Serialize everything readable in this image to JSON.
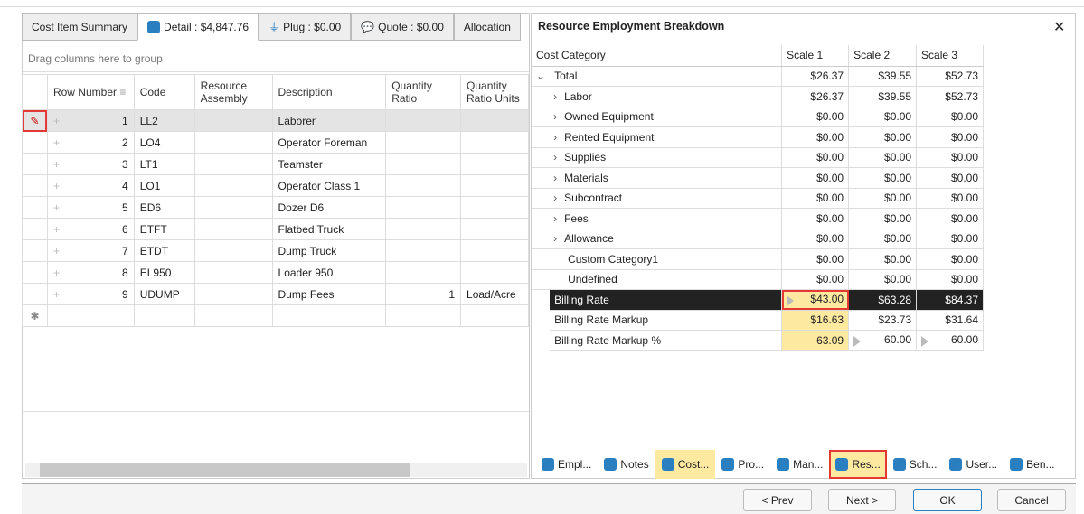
{
  "tabs": [
    {
      "label": "Cost Item Summary"
    },
    {
      "label": "Detail : $4,847.76"
    },
    {
      "label": "Plug : $0.00"
    },
    {
      "label": "Quote : $0.00"
    },
    {
      "label": "Allocation"
    }
  ],
  "group_hint": "Drag columns here to group",
  "grid": {
    "columns": [
      "Row Number",
      "Code",
      "Resource Assembly",
      "Description",
      "Quantity Ratio",
      "Quantity Ratio Units"
    ],
    "rows": [
      {
        "n": "1",
        "code": "LL2",
        "asm": "",
        "desc": "Laborer",
        "qty": "",
        "units": ""
      },
      {
        "n": "2",
        "code": "LO4",
        "asm": "",
        "desc": "Operator Foreman",
        "qty": "",
        "units": ""
      },
      {
        "n": "3",
        "code": "LT1",
        "asm": "",
        "desc": "Teamster",
        "qty": "",
        "units": ""
      },
      {
        "n": "4",
        "code": "LO1",
        "asm": "",
        "desc": "Operator Class 1",
        "qty": "",
        "units": ""
      },
      {
        "n": "5",
        "code": "ED6",
        "asm": "",
        "desc": "Dozer D6",
        "qty": "",
        "units": ""
      },
      {
        "n": "6",
        "code": "ETFT",
        "asm": "",
        "desc": "Flatbed Truck",
        "qty": "",
        "units": ""
      },
      {
        "n": "7",
        "code": "ETDT",
        "asm": "",
        "desc": "Dump Truck",
        "qty": "",
        "units": ""
      },
      {
        "n": "8",
        "code": "EL950",
        "asm": "",
        "desc": "Loader 950",
        "qty": "",
        "units": ""
      },
      {
        "n": "9",
        "code": "UDUMP",
        "asm": "",
        "desc": "Dump Fees",
        "qty": "1",
        "units": "Load/Acre"
      }
    ]
  },
  "panel": {
    "title": "Resource Employment Breakdown",
    "columns": [
      "Cost Category",
      "Scale 1",
      "Scale 2",
      "Scale 3"
    ],
    "rows": [
      {
        "label": "Total",
        "s1": "$26.37",
        "s2": "$39.55",
        "s3": "$52.73"
      },
      {
        "label": "Labor",
        "s1": "$26.37",
        "s2": "$39.55",
        "s3": "$52.73"
      },
      {
        "label": "Owned Equipment",
        "s1": "$0.00",
        "s2": "$0.00",
        "s3": "$0.00"
      },
      {
        "label": "Rented Equipment",
        "s1": "$0.00",
        "s2": "$0.00",
        "s3": "$0.00"
      },
      {
        "label": "Supplies",
        "s1": "$0.00",
        "s2": "$0.00",
        "s3": "$0.00"
      },
      {
        "label": "Materials",
        "s1": "$0.00",
        "s2": "$0.00",
        "s3": "$0.00"
      },
      {
        "label": "Subcontract",
        "s1": "$0.00",
        "s2": "$0.00",
        "s3": "$0.00"
      },
      {
        "label": "Fees",
        "s1": "$0.00",
        "s2": "$0.00",
        "s3": "$0.00"
      },
      {
        "label": "Allowance",
        "s1": "$0.00",
        "s2": "$0.00",
        "s3": "$0.00"
      },
      {
        "label": "Custom Category1",
        "s1": "$0.00",
        "s2": "$0.00",
        "s3": "$0.00"
      },
      {
        "label": "Undefined",
        "s1": "$0.00",
        "s2": "$0.00",
        "s3": "$0.00"
      }
    ],
    "billing": [
      {
        "label": "Billing Rate",
        "s1": "$43.00",
        "s2": "$63.28",
        "s3": "$84.37"
      },
      {
        "label": "Billing Rate Markup",
        "s1": "$16.63",
        "s2": "$23.73",
        "s3": "$31.64"
      },
      {
        "label": "Billing Rate Markup %",
        "s1": "63.09",
        "s2": "60.00",
        "s3": "60.00"
      }
    ]
  },
  "bottom_tabs": [
    "Empl...",
    "Notes",
    "Cost...",
    "Pro...",
    "Man...",
    "Res...",
    "Sch...",
    "User...",
    "Ben..."
  ],
  "buttons": {
    "prev": "< Prev",
    "next": "Next >",
    "ok": "OK",
    "cancel": "Cancel"
  }
}
